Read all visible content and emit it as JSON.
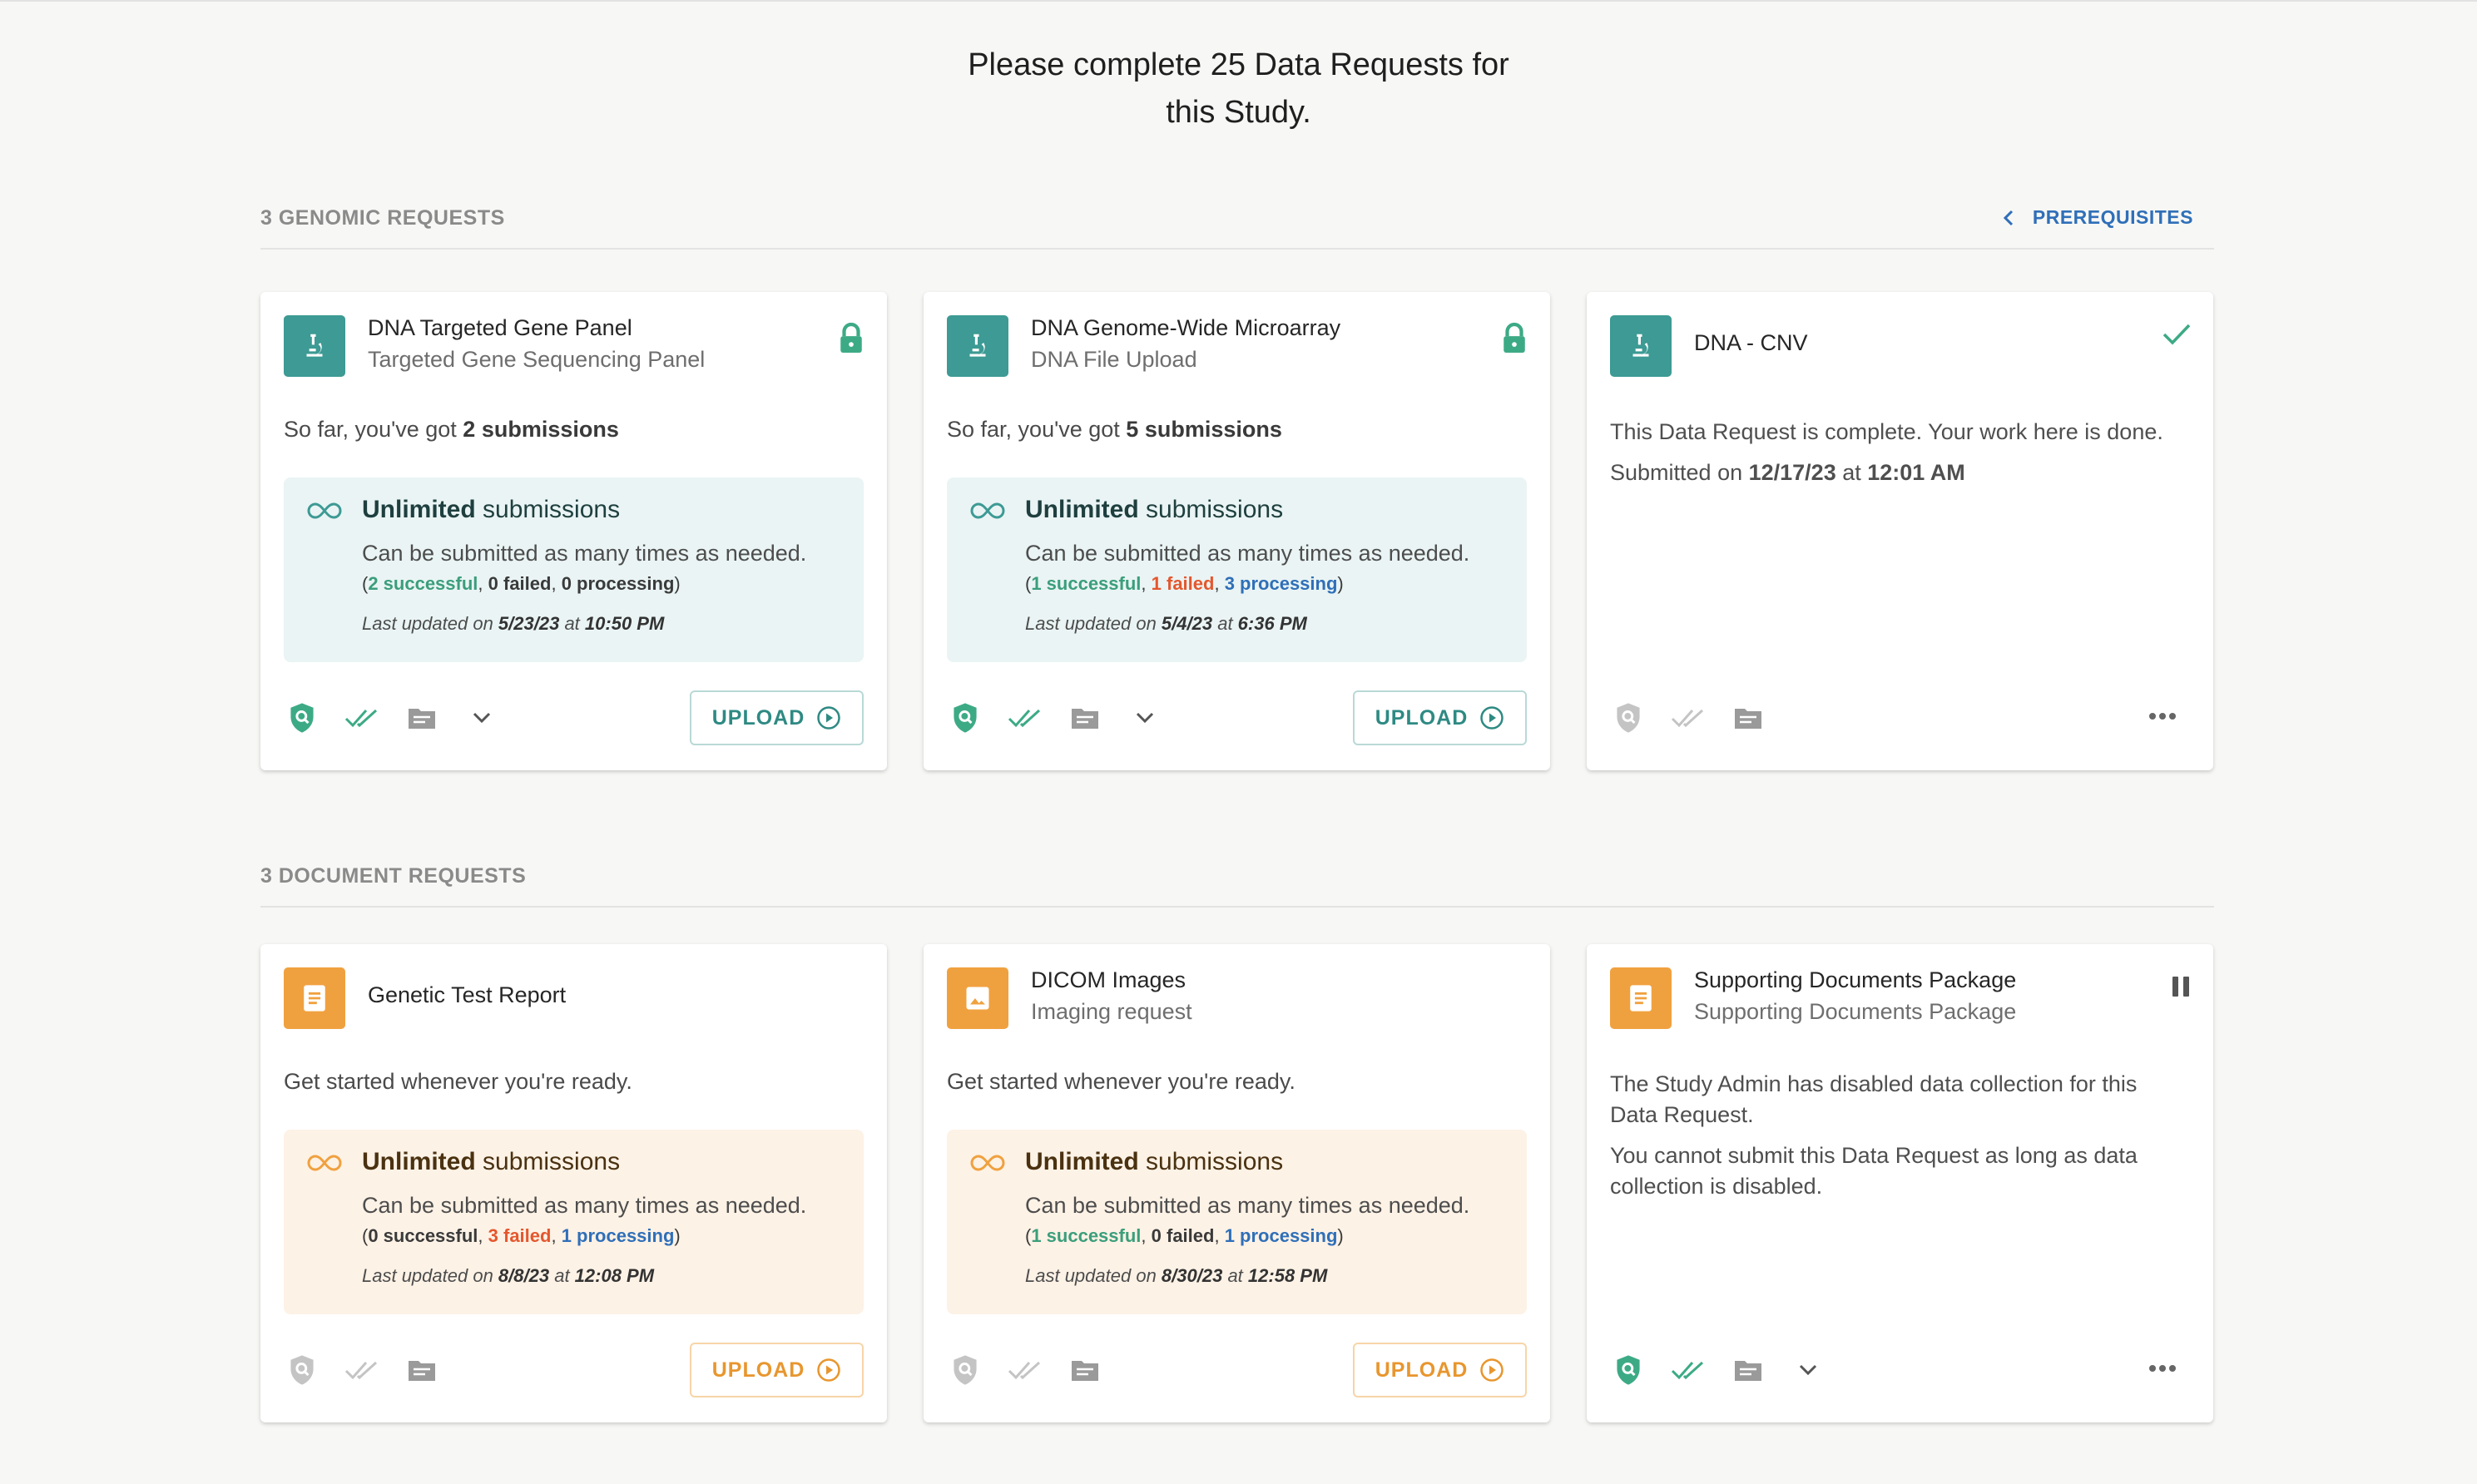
{
  "header": {
    "title_line1": "Please complete 25 Data Requests for",
    "title_line2": "this Study."
  },
  "sections": {
    "genomic": {
      "label": "3 GENOMIC REQUESTS",
      "prereq_label": "PREREQUISITES"
    },
    "document": {
      "label": "3 DOCUMENT REQUESTS"
    }
  },
  "colors": {
    "teal": "#3d9a94",
    "orange": "#f0a13f",
    "success": "#3b9e7b",
    "failed": "#e4572e",
    "processing": "#2f6fb8"
  },
  "cards": [
    {
      "title": "DNA Targeted Gene Panel",
      "subtitle": "Targeted Gene Sequencing Panel",
      "icon": "microscope-icon",
      "status": "lock-icon",
      "intro_prefix": "So far, you've got ",
      "intro_bold": "2 submissions",
      "unlimited_bold": "Unlimited",
      "unlimited_rest": " submissions",
      "desc": "Can be submitted as many times as needed.",
      "successful": "2 successful",
      "failed": "0 failed",
      "processing": "0 processing",
      "updated_prefix": "Last updated on ",
      "updated_date": "5/23/23",
      "updated_at": " at ",
      "updated_time": "10:50 PM",
      "upload_label": "UPLOAD"
    },
    {
      "title": "DNA Genome-Wide Microarray",
      "subtitle": "DNA File Upload",
      "icon": "microscope-icon",
      "status": "lock-icon",
      "intro_prefix": "So far, you've got ",
      "intro_bold": "5 submissions",
      "unlimited_bold": "Unlimited",
      "unlimited_rest": " submissions",
      "desc": "Can be submitted as many times as needed.",
      "successful": "1 successful",
      "failed": "1 failed",
      "processing": "3 processing",
      "updated_prefix": "Last updated on ",
      "updated_date": "5/4/23",
      "updated_at": " at ",
      "updated_time": "6:36 PM",
      "upload_label": "UPLOAD"
    },
    {
      "title": "DNA - CNV",
      "icon": "microscope-icon",
      "status": "checkmark-icon",
      "msg1": "This Data Request is complete. Your work here is done.",
      "submitted_prefix": "Submitted on ",
      "submitted_date": "12/17/23",
      "submitted_at": " at ",
      "submitted_time": "12:01 AM"
    },
    {
      "title": "Genetic Test Report",
      "icon": "document-icon",
      "intro_prefix": "Get started whenever you're ready.",
      "unlimited_bold": "Unlimited",
      "unlimited_rest": " submissions",
      "desc": "Can be submitted as many times as needed.",
      "successful": "0 successful",
      "failed": "3 failed",
      "processing": "1 processing",
      "updated_prefix": "Last updated on ",
      "updated_date": "8/8/23",
      "updated_at": " at ",
      "updated_time": "12:08 PM",
      "upload_label": "UPLOAD"
    },
    {
      "title": "DICOM Images",
      "subtitle": "Imaging request",
      "icon": "image-icon",
      "intro_prefix": "Get started whenever you're ready.",
      "unlimited_bold": "Unlimited",
      "unlimited_rest": " submissions",
      "desc": "Can be submitted as many times as needed.",
      "successful": "1 successful",
      "failed": "0 failed",
      "processing": "1 processing",
      "updated_prefix": "Last updated on ",
      "updated_date": "8/30/23",
      "updated_at": " at ",
      "updated_time": "12:58 PM",
      "upload_label": "UPLOAD"
    },
    {
      "title": "Supporting Documents Package",
      "subtitle": "Supporting Documents Package",
      "icon": "document-icon",
      "status": "pause-icon",
      "msg1": "The Study Admin has disabled data collection for this Data Request.",
      "msg2": "You cannot submit this Data Request as long as data collection is disabled."
    }
  ]
}
